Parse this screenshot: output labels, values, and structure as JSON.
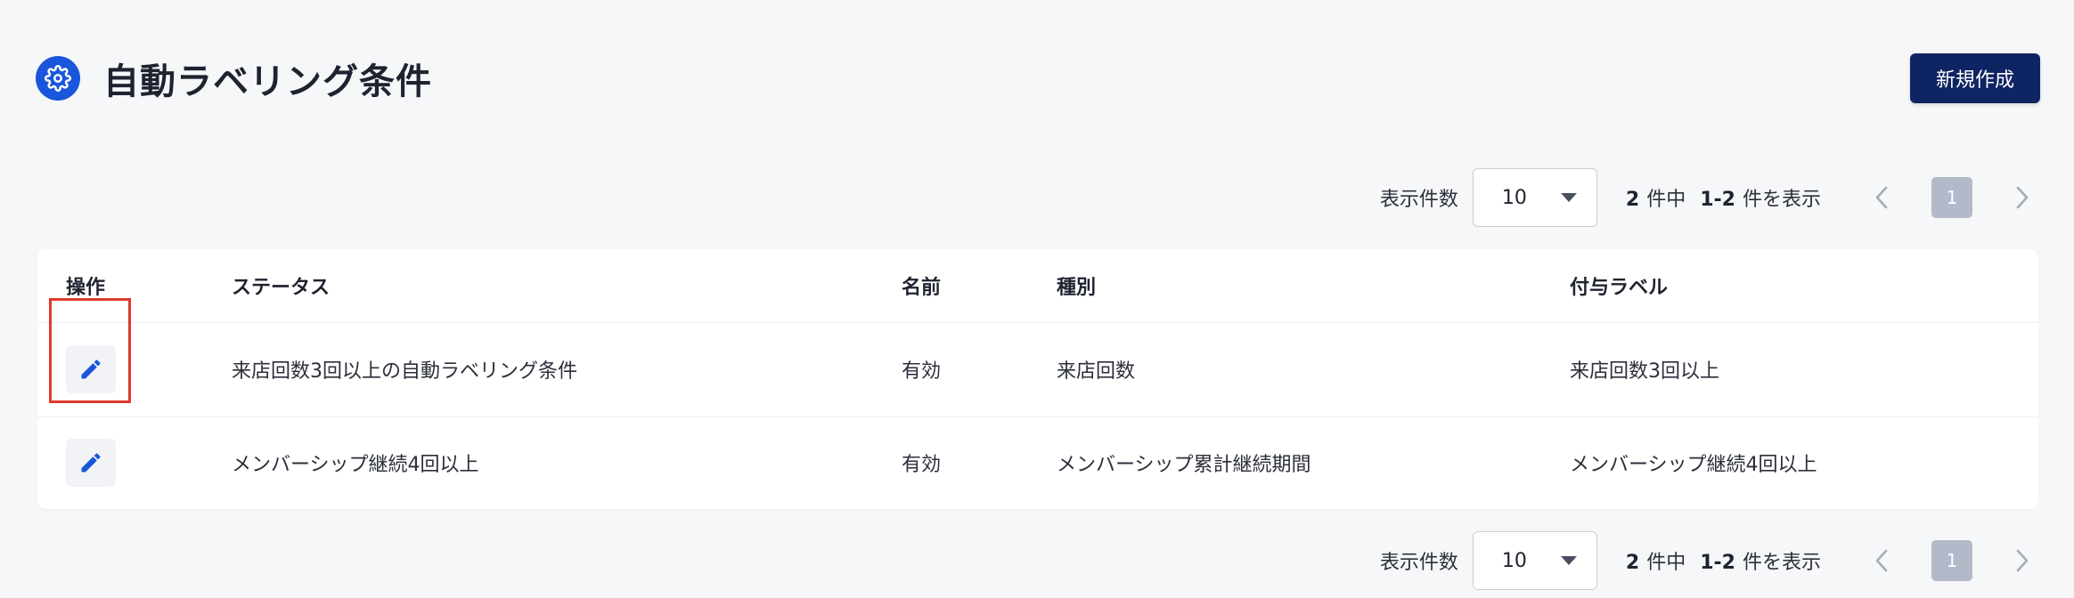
{
  "header": {
    "title": "自動ラベリング条件",
    "icon": "gear-icon",
    "new_button_label": "新規作成"
  },
  "pagination": {
    "per_page_label": "表示件数",
    "per_page_value": "10",
    "total": "2",
    "total_suffix": "件中",
    "range": "1-2",
    "range_suffix": "件を表示",
    "current_page": "1"
  },
  "table": {
    "columns": [
      "操作",
      "ステータス",
      "名前",
      "種別",
      "付与ラベル"
    ],
    "rows": [
      {
        "name": "来店回数3回以上の自動ラベリング条件",
        "status": "有効",
        "type": "来店回数",
        "label": "来店回数3回以上"
      },
      {
        "name": "メンバーシップ継続4回以上",
        "status": "有効",
        "type": "メンバーシップ累計継続期間",
        "label": "メンバーシップ継続4回以上"
      }
    ]
  },
  "colors": {
    "accent": "#1a56db",
    "primary_button": "#0f2463",
    "highlight": "#e0392b",
    "page_active": "#b4b9ca"
  }
}
